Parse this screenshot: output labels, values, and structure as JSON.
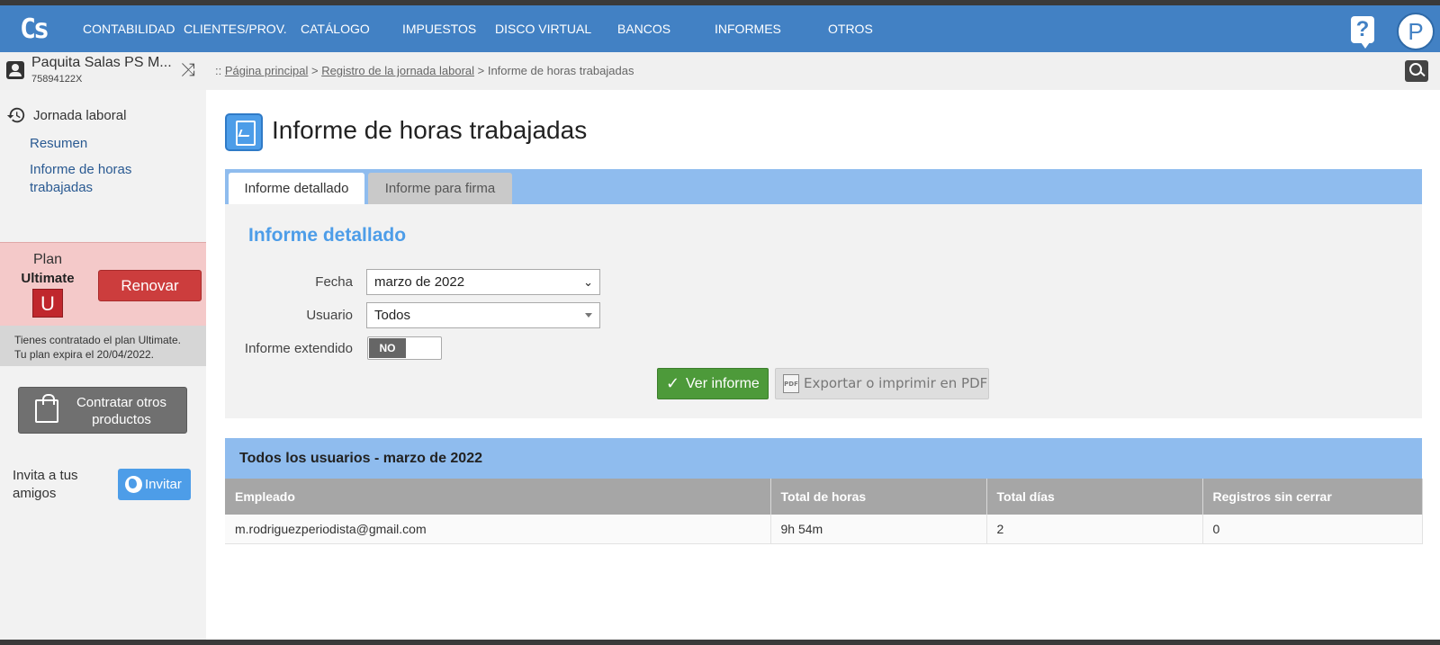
{
  "nav": {
    "logo": "Cs",
    "items": [
      "CONTABILIDAD",
      "CLIENTES/PROV.",
      "CATÁLOGO",
      "IMPUESTOS",
      "DISCO VIRTUAL",
      "BANCOS",
      "INFORMES",
      "OTROS"
    ],
    "help_label": "?",
    "avatar_letter": "P"
  },
  "company": {
    "name": "Paquita Salas PS M...",
    "id": "75894122X"
  },
  "breadcrumb": {
    "prefix": ":: ",
    "home": "Página principal",
    "sep": " > ",
    "section": "Registro de la jornada laboral",
    "current": "Informe de horas trabajadas"
  },
  "sidebar": {
    "heading": "Jornada laboral",
    "links": [
      "Resumen",
      "Informe de horas trabajadas"
    ],
    "plan_label": "Plan",
    "plan_name": "Ultimate",
    "plan_badge": "U",
    "renew_label": "Renovar",
    "plan_info_1": "Tienes contratado el plan Ultimate.",
    "plan_info_2": "Tu plan expira el 20/04/2022.",
    "buy_label": "Contratar otros productos",
    "invite_text": "Invita a tus amigos",
    "invite_label": "Invitar"
  },
  "page": {
    "title": "Informe de horas trabajadas"
  },
  "tabs": [
    "Informe detallado",
    "Informe para firma"
  ],
  "form": {
    "title": "Informe detallado",
    "fecha_label": "Fecha",
    "fecha_value": "marzo de 2022",
    "usuario_label": "Usuario",
    "usuario_value": "Todos",
    "extendido_label": "Informe extendido",
    "extendido_value": "NO",
    "ver_label": "Ver informe",
    "pdf_label": "Exportar o imprimir en PDF",
    "pdf_icon_text": "PDF"
  },
  "results": {
    "heading": "Todos los usuarios - marzo de 2022",
    "columns": [
      "Empleado",
      "Total de horas",
      "Total días",
      "Registros sin cerrar"
    ],
    "rows": [
      [
        "m.rodriguezperiodista@gmail.com",
        "9h 54m",
        "2",
        "0"
      ]
    ]
  },
  "colors": {
    "nav_bg": "#4281c4",
    "accent_blue": "#4d9de8",
    "tab_bar": "#8fbcee",
    "renew": "#cc3d3d",
    "ver_button": "#4d9a3a"
  }
}
